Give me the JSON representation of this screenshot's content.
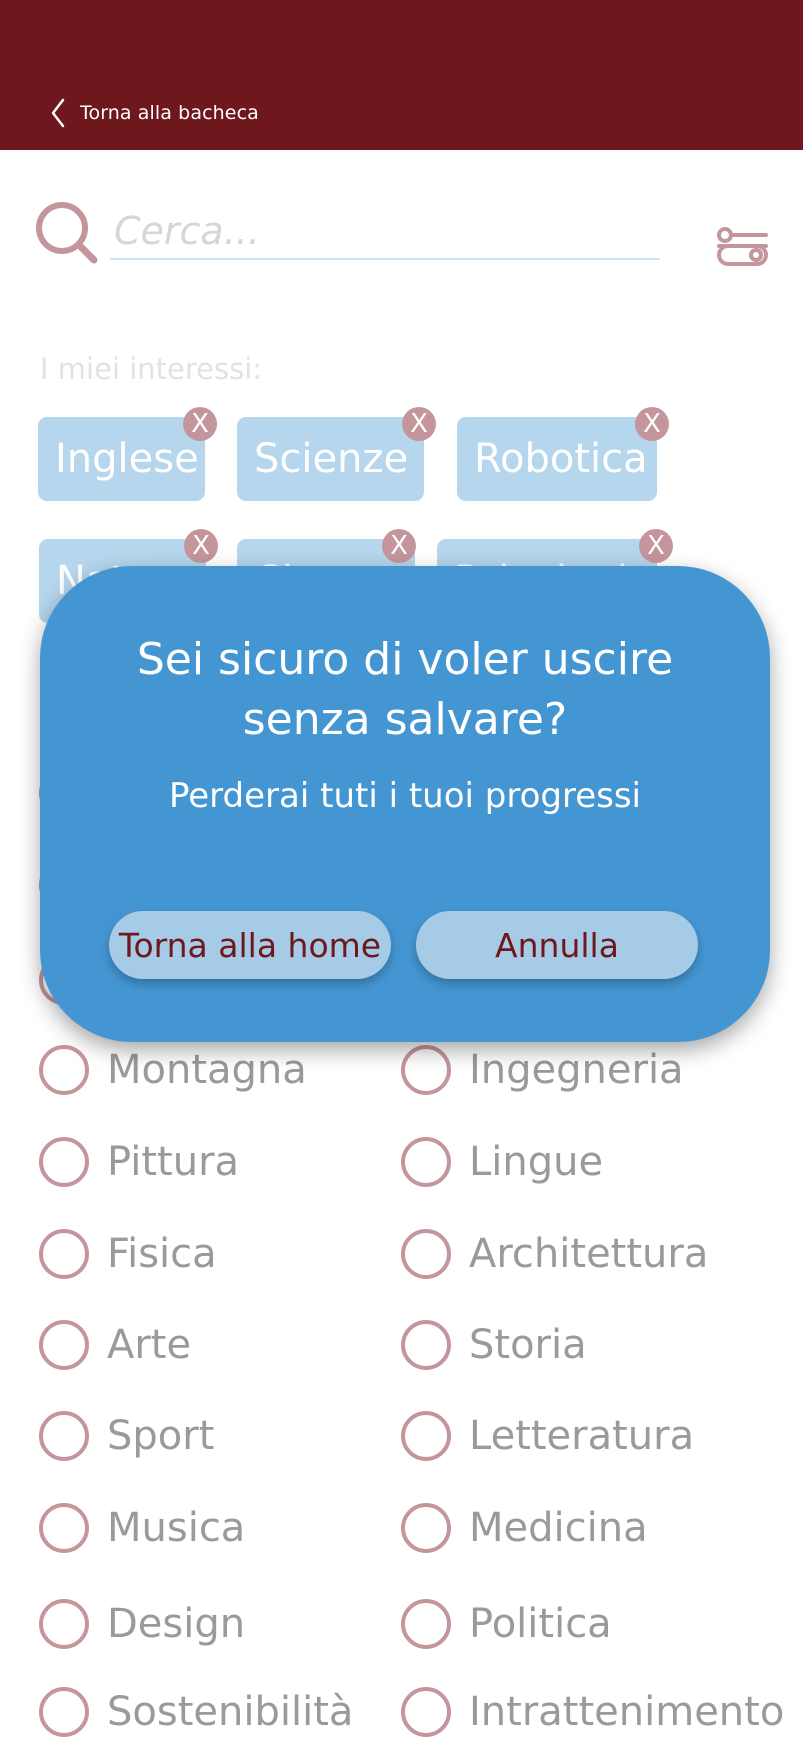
{
  "header": {
    "back_label": "Torna alla bacheca"
  },
  "search": {
    "placeholder": "Cerca..."
  },
  "interests": {
    "title": "I miei interessi:",
    "chips": [
      "Inglese",
      "Scienze",
      "Robotica",
      "Natura",
      "Cinema",
      "Psicologia"
    ],
    "remove_label": "X"
  },
  "options": {
    "left": [
      "Montagna",
      "Pittura",
      "Fisica",
      "Arte",
      "Sport",
      "Musica",
      "Design",
      "Sostenibilità"
    ],
    "right": [
      "Ingegneria",
      "Lingue",
      "Architettura",
      "Storia",
      "Letteratura",
      "Medicina",
      "Politica",
      "Intrattenimento"
    ]
  },
  "modal": {
    "title": "Sei sicuro di voler uscire\nsenza salvare?",
    "message": "Perderai tuti i tuoi progressi",
    "confirm_label": "Torna alla home",
    "cancel_label": "Annulla"
  },
  "colors": {
    "header_bg": "#6e171d",
    "accent_blue": "#4496d3",
    "chip_blue": "#b5d6ec",
    "icon_rose": "#c4969c"
  }
}
